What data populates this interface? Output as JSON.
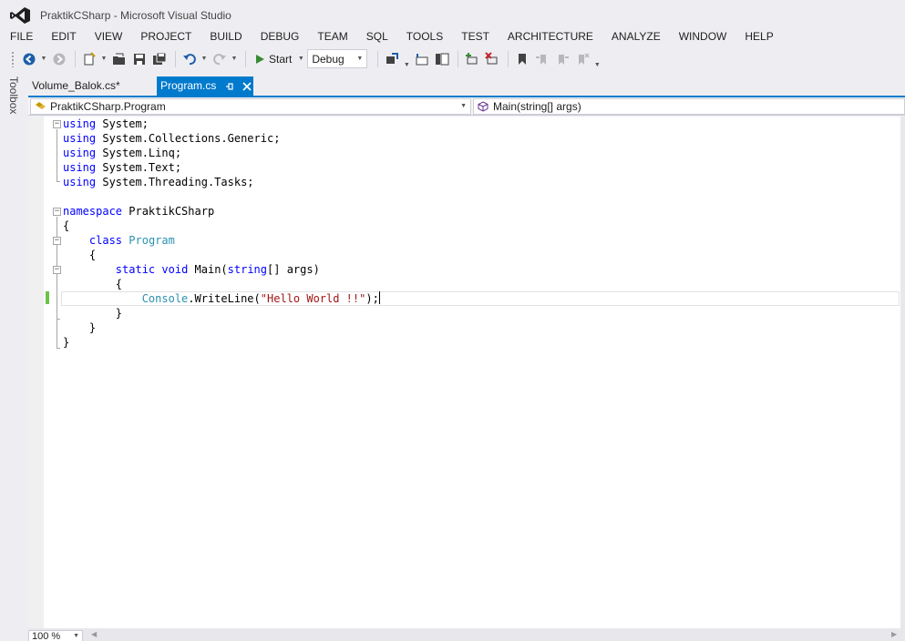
{
  "window": {
    "title": "PraktikCSharp - Microsoft Visual Studio"
  },
  "menu": {
    "items": [
      "FILE",
      "EDIT",
      "VIEW",
      "PROJECT",
      "BUILD",
      "DEBUG",
      "TEAM",
      "SQL",
      "TOOLS",
      "TEST",
      "ARCHITECTURE",
      "ANALYZE",
      "WINDOW",
      "HELP"
    ]
  },
  "toolbar": {
    "start_label": "Start",
    "config_value": "Debug",
    "icons": [
      "back-icon",
      "forward-icon",
      "new-project-icon",
      "open-file-icon",
      "save-icon",
      "save-all-icon",
      "undo-icon",
      "redo-icon",
      "start-icon",
      "attach-icon",
      "step-icon",
      "bookmark-icon"
    ]
  },
  "toolbox": {
    "label": "Toolbox"
  },
  "tabs": [
    {
      "label": "Volume_Balok.cs*",
      "active": false
    },
    {
      "label": "Program.cs",
      "active": true
    }
  ],
  "navbar": {
    "type_value": "PraktikCSharp.Program",
    "member_value": "Main(string[] args)"
  },
  "code": {
    "lines": [
      [
        {
          "t": "using",
          "c": "kw"
        },
        {
          "t": " System;"
        }
      ],
      [
        {
          "t": "using",
          "c": "kw"
        },
        {
          "t": " System.Collections.Generic;"
        }
      ],
      [
        {
          "t": "using",
          "c": "kw"
        },
        {
          "t": " System.Linq;"
        }
      ],
      [
        {
          "t": "using",
          "c": "kw"
        },
        {
          "t": " System.Text;"
        }
      ],
      [
        {
          "t": "using",
          "c": "kw"
        },
        {
          "t": " System.Threading.Tasks;"
        }
      ],
      [],
      [
        {
          "t": "namespace",
          "c": "kw"
        },
        {
          "t": " PraktikCSharp"
        }
      ],
      [
        {
          "t": "{"
        }
      ],
      [
        {
          "t": "    "
        },
        {
          "t": "class",
          "c": "kw"
        },
        {
          "t": " "
        },
        {
          "t": "Program",
          "c": "ty"
        }
      ],
      [
        {
          "t": "    {"
        }
      ],
      [
        {
          "t": "        "
        },
        {
          "t": "static",
          "c": "kw"
        },
        {
          "t": " "
        },
        {
          "t": "void",
          "c": "kw"
        },
        {
          "t": " Main("
        },
        {
          "t": "string",
          "c": "kw"
        },
        {
          "t": "[] args)"
        }
      ],
      [
        {
          "t": "        {"
        }
      ],
      [
        {
          "t": "            "
        },
        {
          "t": "Console",
          "c": "ty"
        },
        {
          "t": ".WriteLine("
        },
        {
          "t": "\"Hello World !!\"",
          "c": "str"
        },
        {
          "t": ");"
        }
      ],
      [
        {
          "t": "        }"
        }
      ],
      [
        {
          "t": "    }"
        }
      ],
      [
        {
          "t": "}"
        }
      ]
    ],
    "caret_line": 12
  },
  "status": {
    "zoom": "100 %"
  },
  "colors": {
    "accent": "#007acc",
    "keyword": "#0000ff",
    "type": "#2b91af",
    "string": "#a31515",
    "change_marker": "#6cc24a"
  }
}
